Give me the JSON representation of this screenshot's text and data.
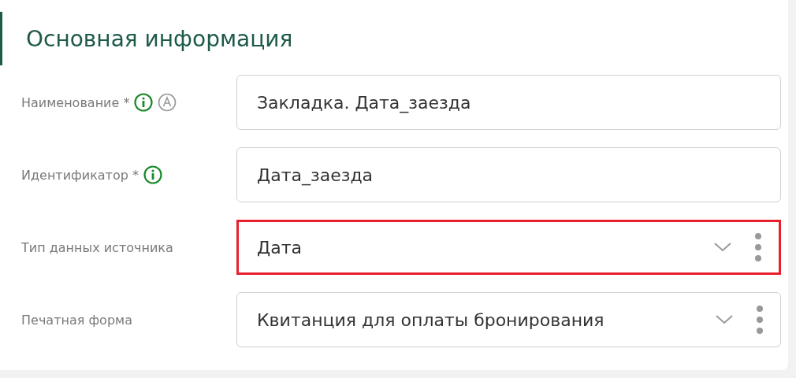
{
  "section": {
    "title": "Основная информация"
  },
  "fields": [
    {
      "kind": "text",
      "label": "Наименование *",
      "info": true,
      "auto": true,
      "value": "Закладка. Дата_заезда",
      "highlighted": false
    },
    {
      "kind": "text",
      "label": "Идентификатор *",
      "info": true,
      "auto": false,
      "value": "Дата_заезда",
      "highlighted": false
    },
    {
      "kind": "select",
      "label": "Тип данных источника",
      "info": false,
      "auto": false,
      "value": "Дата",
      "highlighted": true
    },
    {
      "kind": "select",
      "label": "Печатная форма",
      "info": false,
      "auto": false,
      "value": "Квитанция для оплаты бронирования",
      "highlighted": false
    }
  ]
}
